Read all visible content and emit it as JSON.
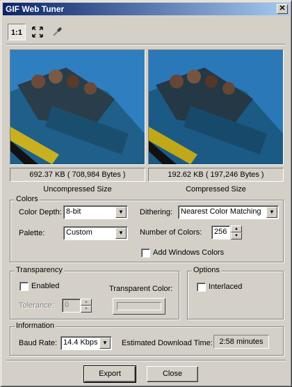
{
  "window": {
    "title": "GIF Web Tuner",
    "close_glyph": "✕"
  },
  "toolbar": {
    "actual_size_label": "1:1",
    "fit_icon": "fit-to-window-icon",
    "eyedropper_icon": "eyedropper-icon"
  },
  "preview": {
    "uncompressed_size": "692.37 KB ( 708,984 Bytes )",
    "uncompressed_caption": "Uncompressed Size",
    "compressed_size": "192.62 KB ( 197,246 Bytes )",
    "compressed_caption": "Compressed Size"
  },
  "colors": {
    "group_label": "Colors",
    "color_depth_label": "Color Depth:",
    "color_depth_value": "8-bit",
    "palette_label": "Palette:",
    "palette_value": "Custom",
    "dithering_label": "Dithering:",
    "dithering_value": "Nearest Color Matching",
    "num_colors_label": "Number of Colors:",
    "num_colors_value": "256",
    "add_windows_colors_label": "Add Windows Colors"
  },
  "transparency": {
    "group_label": "Transparency",
    "enabled_label": "Enabled",
    "tolerance_label": "Tolerance:",
    "tolerance_value": "0",
    "transparent_color_label": "Transparent Color:"
  },
  "options": {
    "group_label": "Options",
    "interlaced_label": "Interlaced"
  },
  "information": {
    "group_label": "Information",
    "baud_rate_label": "Baud Rate:",
    "baud_rate_value": "14.4 Kbps",
    "download_time_label": "Estimated Download Time:",
    "download_time_value": "2:58 minutes"
  },
  "buttons": {
    "export_label": "Export",
    "close_label": "Close"
  },
  "glyphs": {
    "down_arrow": "▼",
    "up_arrow": "▲"
  }
}
